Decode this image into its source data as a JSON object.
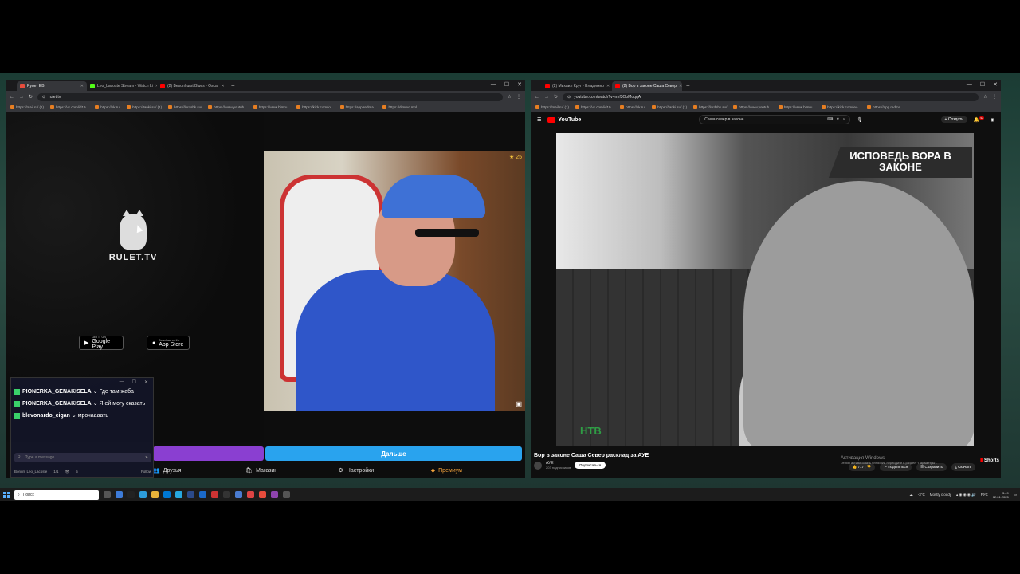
{
  "left_window": {
    "tabs": [
      {
        "label": "Рулет ЕВ",
        "favicon_color": "#e74c3c",
        "active": true
      },
      {
        "label": "Leo_Lacoste Stream - Watch Li",
        "favicon_color": "#53fc18",
        "active": false
      },
      {
        "label": "(2) Besonhurst Blues - Oscar",
        "favicon_color": "#ff0000",
        "active": false
      }
    ],
    "url": "rulet.tv",
    "bookmarks": [
      "https://mail.ru/ (1)",
      "https://vk.com/id19...",
      "https://ok.ru/",
      "https://tanki.su/ (1)",
      "https://lordsbk.su/",
      "https://www.youtub...",
      "https://www.bimru...",
      "https://kick.com/lo...",
      "https://app.redma...",
      "https://dimmo.mol..."
    ]
  },
  "rulet": {
    "logo_text": "RULET.TV",
    "google_play": {
      "small": "GET IT ON",
      "label": "Google Play"
    },
    "app_store": {
      "small": "Download on the",
      "label": "App Store"
    },
    "cam_rating": "25",
    "next_button_label": "Дальше",
    "nav": [
      {
        "icon": "friends-icon",
        "label": "Друзья"
      },
      {
        "icon": "shop-icon",
        "label": "Магазин"
      },
      {
        "icon": "gear-icon",
        "label": "Настройки"
      },
      {
        "icon": "premium-icon",
        "label": "Премиум"
      }
    ]
  },
  "chat": {
    "messages": [
      {
        "user": "PIONERKA_GENAKISELA",
        "text": "Где там жаба"
      },
      {
        "user": "PIONERKA_GENAKISELA",
        "text": "Я ей могу сказать"
      },
      {
        "user": "blevonardo_cigan",
        "text": "мрочаааать"
      }
    ],
    "input_placeholder": "Type a message...",
    "status_name": "Bonum Leo_Lacoste",
    "status_count": "1/1",
    "status_views": "5",
    "status_right": "Follow"
  },
  "right_window": {
    "tabs": [
      {
        "label": "(2) Михаил Круг - Владимир",
        "favicon_color": "#ff0000",
        "active": false
      },
      {
        "label": "(2) Вор в законе Саша Север",
        "favicon_color": "#ff0000",
        "active": true
      }
    ],
    "url": "youtube.com/watch?v=mrf3OoMoqqA",
    "bookmarks": [
      "https://mail.ru/ (1)",
      "https://vk.com/id19...",
      "https://ok.ru/",
      "https://tanki.su/ (1)",
      "https://lordsbk.su/",
      "https://www.youtub...",
      "https://www.bimru...",
      "https://kick.com/leo...",
      "https://app.redma..."
    ]
  },
  "youtube": {
    "logo": "YouTube",
    "search_query": "Саша север в законе",
    "create_label": "+ Создать",
    "notification_count": "9+",
    "video_banner": "ИСПОВЕДЬ ВОРА В ЗАКОНЕ",
    "video_logo": "НТВ",
    "title": "Вор в законе Саша Север расклад за АУЕ",
    "channel": "АУЕ",
    "subscribers": "203 подписчиков",
    "subscribe_label": "Подписаться",
    "likes": "717",
    "share_label": "Поделиться",
    "save_label": "Сохранить",
    "download_label": "Скачать",
    "shorts_label": "Shorts"
  },
  "overlay": {
    "activation_title": "Активация Windows",
    "activation_text": "Чтобы активировать Windows, перейдите в раздел \"Параметры\"."
  },
  "taskbar": {
    "search_placeholder": "Поиск",
    "weather": "-3°C",
    "weather_text": "Mostly cloudy",
    "language": "РУС",
    "time": "3:49",
    "date": "02.01.2025"
  }
}
